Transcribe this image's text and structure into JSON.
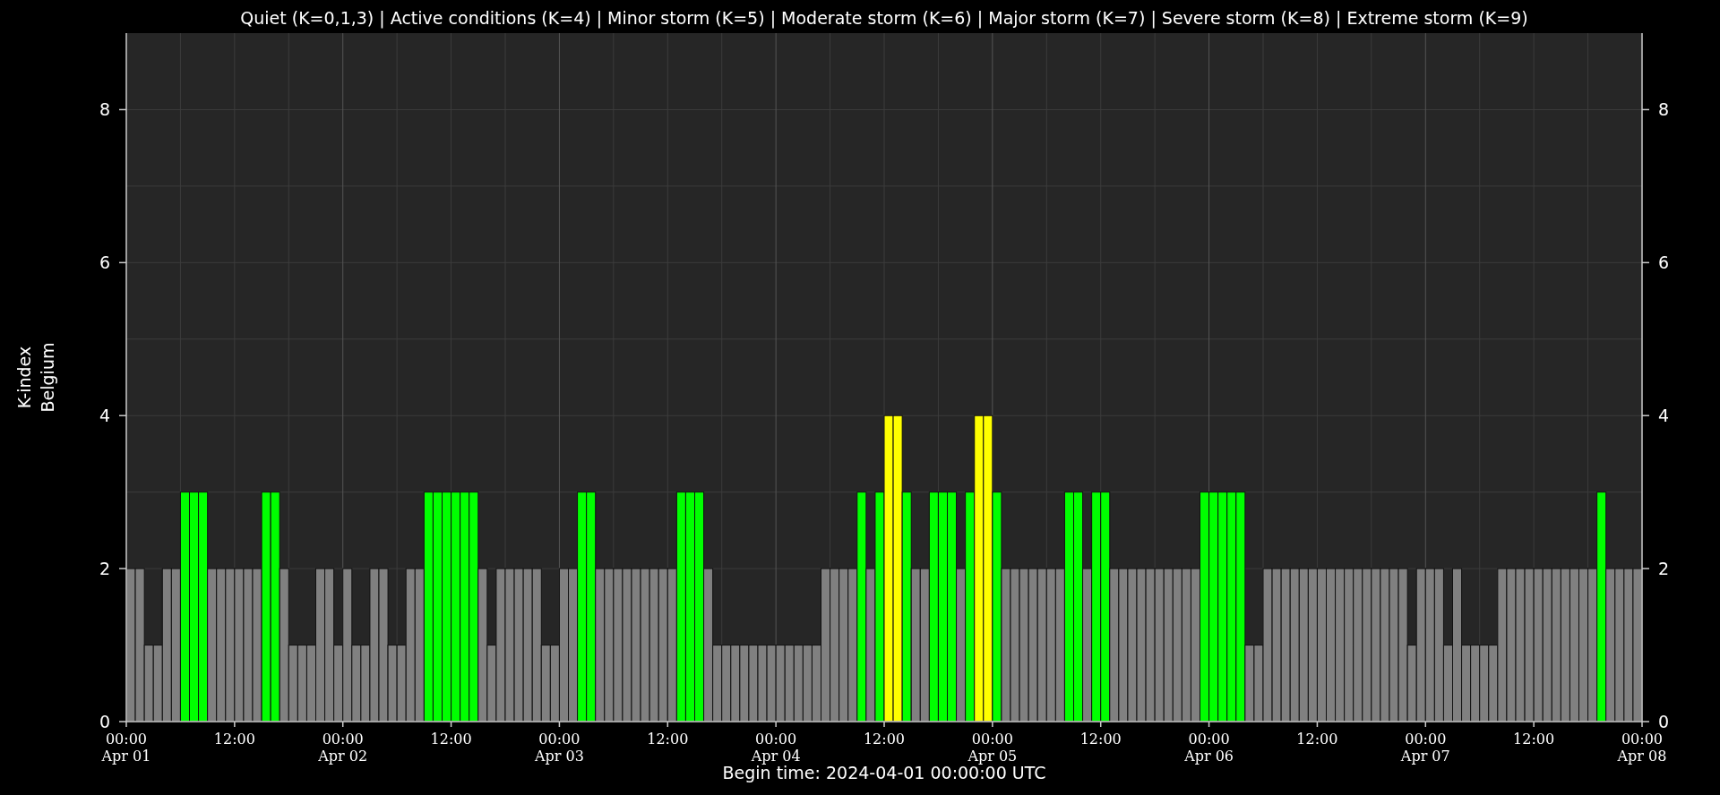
{
  "chart_data": {
    "type": "bar",
    "grid": true,
    "title": "Quiet (K=0,1,3) | Active conditions (K=4) | Minor storm (K=5) | Moderate storm (K=6) | Major storm (K=7) | Severe storm (K=8) | Extreme storm (K=9)",
    "ylabel": [
      "K-index",
      "Belgium"
    ],
    "xlabel": "Begin time: 2024-04-01 00:00:00 UTC",
    "xlim": [
      "2024-04-01T00:00",
      "2024-04-08T00:00"
    ],
    "ylim": [
      0,
      9
    ],
    "yticks": [
      0,
      2,
      4,
      6,
      8
    ],
    "y2lim": [
      0,
      9
    ],
    "y2ticks": [
      0,
      2,
      4,
      6,
      8
    ],
    "xticks": [
      {
        "value": "2024-04-01T00:00",
        "label": "00:00\nApr 01"
      },
      {
        "value": "2024-04-01T12:00",
        "label": "12:00"
      },
      {
        "value": "2024-04-02T00:00",
        "label": "00:00\nApr 02"
      },
      {
        "value": "2024-04-02T12:00",
        "label": "12:00"
      },
      {
        "value": "2024-04-03T00:00",
        "label": "00:00\nApr 03"
      },
      {
        "value": "2024-04-03T12:00",
        "label": "12:00"
      },
      {
        "value": "2024-04-04T00:00",
        "label": "00:00\nApr 04"
      },
      {
        "value": "2024-04-04T12:00",
        "label": "12:00"
      },
      {
        "value": "2024-04-05T00:00",
        "label": "00:00\nApr 05"
      },
      {
        "value": "2024-04-05T12:00",
        "label": "12:00"
      },
      {
        "value": "2024-04-06T00:00",
        "label": "00:00\nApr 06"
      },
      {
        "value": "2024-04-06T12:00",
        "label": "12:00"
      },
      {
        "value": "2024-04-07T00:00",
        "label": "00:00\nApr 07"
      },
      {
        "value": "2024-04-07T12:00",
        "label": "12:00"
      },
      {
        "value": "2024-04-08T00:00",
        "label": "00:00\nApr 08"
      }
    ],
    "x": [
      "2024-04-01T00:00",
      "2024-04-01T01:00",
      "2024-04-01T02:00",
      "2024-04-01T03:00",
      "2024-04-01T04:00",
      "2024-04-01T05:00",
      "2024-04-01T06:00",
      "2024-04-01T07:00",
      "2024-04-01T08:00",
      "2024-04-01T09:00",
      "2024-04-01T10:00",
      "2024-04-01T11:00",
      "2024-04-01T12:00",
      "2024-04-01T13:00",
      "2024-04-01T14:00",
      "2024-04-01T15:00",
      "2024-04-01T16:00",
      "2024-04-01T17:00",
      "2024-04-01T18:00",
      "2024-04-01T19:00",
      "2024-04-01T20:00",
      "2024-04-01T21:00",
      "2024-04-01T22:00",
      "2024-04-01T23:00",
      "2024-04-02T00:00",
      "2024-04-02T01:00",
      "2024-04-02T02:00",
      "2024-04-02T03:00",
      "2024-04-02T04:00",
      "2024-04-02T05:00",
      "2024-04-02T06:00",
      "2024-04-02T07:00",
      "2024-04-02T08:00",
      "2024-04-02T09:00",
      "2024-04-02T10:00",
      "2024-04-02T11:00",
      "2024-04-02T12:00",
      "2024-04-02T13:00",
      "2024-04-02T14:00",
      "2024-04-02T15:00",
      "2024-04-02T16:00",
      "2024-04-02T17:00",
      "2024-04-02T18:00",
      "2024-04-02T19:00",
      "2024-04-02T20:00",
      "2024-04-02T21:00",
      "2024-04-02T22:00",
      "2024-04-02T23:00",
      "2024-04-03T00:00",
      "2024-04-03T01:00",
      "2024-04-03T02:00",
      "2024-04-03T03:00",
      "2024-04-03T04:00",
      "2024-04-03T05:00",
      "2024-04-03T06:00",
      "2024-04-03T07:00",
      "2024-04-03T08:00",
      "2024-04-03T09:00",
      "2024-04-03T10:00",
      "2024-04-03T11:00",
      "2024-04-03T12:00",
      "2024-04-03T13:00",
      "2024-04-03T14:00",
      "2024-04-03T15:00",
      "2024-04-03T16:00",
      "2024-04-03T17:00",
      "2024-04-03T18:00",
      "2024-04-03T19:00",
      "2024-04-03T20:00",
      "2024-04-03T21:00",
      "2024-04-03T22:00",
      "2024-04-03T23:00",
      "2024-04-04T00:00",
      "2024-04-04T01:00",
      "2024-04-04T02:00",
      "2024-04-04T03:00",
      "2024-04-04T04:00",
      "2024-04-04T05:00",
      "2024-04-04T06:00",
      "2024-04-04T07:00",
      "2024-04-04T08:00",
      "2024-04-04T09:00",
      "2024-04-04T10:00",
      "2024-04-04T11:00",
      "2024-04-04T12:00",
      "2024-04-04T13:00",
      "2024-04-04T14:00",
      "2024-04-04T15:00",
      "2024-04-04T16:00",
      "2024-04-04T17:00",
      "2024-04-04T18:00",
      "2024-04-04T19:00",
      "2024-04-04T20:00",
      "2024-04-04T21:00",
      "2024-04-04T22:00",
      "2024-04-04T23:00",
      "2024-04-05T00:00",
      "2024-04-05T01:00",
      "2024-04-05T02:00",
      "2024-04-05T03:00",
      "2024-04-05T04:00",
      "2024-04-05T05:00",
      "2024-04-05T06:00",
      "2024-04-05T07:00",
      "2024-04-05T08:00",
      "2024-04-05T09:00",
      "2024-04-05T10:00",
      "2024-04-05T11:00",
      "2024-04-05T12:00",
      "2024-04-05T13:00",
      "2024-04-05T14:00",
      "2024-04-05T15:00",
      "2024-04-05T16:00",
      "2024-04-05T17:00",
      "2024-04-05T18:00",
      "2024-04-05T19:00",
      "2024-04-05T20:00",
      "2024-04-05T21:00",
      "2024-04-05T22:00",
      "2024-04-05T23:00",
      "2024-04-06T00:00",
      "2024-04-06T01:00",
      "2024-04-06T02:00",
      "2024-04-06T03:00",
      "2024-04-06T04:00",
      "2024-04-06T05:00",
      "2024-04-06T06:00",
      "2024-04-06T07:00",
      "2024-04-06T08:00",
      "2024-04-06T09:00",
      "2024-04-06T10:00",
      "2024-04-06T11:00",
      "2024-04-06T12:00",
      "2024-04-06T13:00",
      "2024-04-06T14:00",
      "2024-04-06T15:00",
      "2024-04-06T16:00",
      "2024-04-06T17:00",
      "2024-04-06T18:00",
      "2024-04-06T19:00",
      "2024-04-06T20:00",
      "2024-04-06T21:00",
      "2024-04-06T22:00",
      "2024-04-06T23:00",
      "2024-04-07T00:00",
      "2024-04-07T01:00",
      "2024-04-07T02:00",
      "2024-04-07T03:00",
      "2024-04-07T04:00",
      "2024-04-07T05:00",
      "2024-04-07T06:00",
      "2024-04-07T07:00",
      "2024-04-07T08:00",
      "2024-04-07T09:00",
      "2024-04-07T10:00",
      "2024-04-07T11:00",
      "2024-04-07T12:00",
      "2024-04-07T13:00",
      "2024-04-07T14:00",
      "2024-04-07T15:00",
      "2024-04-07T16:00",
      "2024-04-07T17:00",
      "2024-04-07T18:00",
      "2024-04-07T19:00",
      "2024-04-07T20:00",
      "2024-04-07T21:00",
      "2024-04-07T22:00",
      "2024-04-07T23:00"
    ],
    "series": [
      {
        "color": "#808080",
        "values": [
          2,
          2,
          1,
          1,
          2,
          2,
          null,
          null,
          null,
          2,
          2,
          2,
          2,
          2,
          2,
          null,
          null,
          2,
          1,
          1,
          1,
          2,
          2,
          1,
          2,
          1,
          1,
          2,
          2,
          1,
          1,
          2,
          2,
          null,
          null,
          null,
          null,
          null,
          null,
          2,
          1,
          2,
          2,
          2,
          2,
          2,
          1,
          1,
          2,
          2,
          null,
          null,
          2,
          2,
          2,
          2,
          2,
          2,
          2,
          2,
          2,
          null,
          null,
          null,
          2,
          1,
          1,
          1,
          1,
          1,
          1,
          1,
          1,
          1,
          1,
          1,
          1,
          2,
          2,
          2,
          2,
          null,
          2,
          null,
          null,
          null,
          null,
          2,
          2,
          null,
          null,
          null,
          2,
          null,
          null,
          null,
          null,
          2,
          2,
          2,
          2,
          2,
          2,
          2,
          null,
          null,
          2,
          null,
          null,
          2,
          2,
          2,
          2,
          2,
          2,
          2,
          2,
          2,
          2,
          null,
          null,
          null,
          null,
          null,
          1,
          1,
          2,
          2,
          2,
          2,
          2,
          2,
          2,
          2,
          2,
          2,
          2,
          2,
          2,
          2,
          2,
          2,
          1,
          2,
          2,
          2,
          1,
          2,
          1,
          1,
          1,
          1,
          2,
          2,
          2,
          2,
          2,
          2,
          2,
          2,
          2,
          2,
          2,
          null,
          2,
          2,
          2,
          2
        ]
      },
      {
        "color": "#00ff00",
        "values": [
          null,
          null,
          null,
          null,
          null,
          null,
          3,
          3,
          3,
          null,
          null,
          null,
          null,
          null,
          null,
          3,
          3,
          null,
          null,
          null,
          null,
          null,
          null,
          null,
          null,
          null,
          null,
          null,
          null,
          null,
          null,
          null,
          null,
          3,
          3,
          3,
          3,
          3,
          3,
          null,
          null,
          null,
          null,
          null,
          null,
          null,
          null,
          null,
          null,
          null,
          3,
          3,
          null,
          null,
          null,
          null,
          null,
          null,
          null,
          null,
          null,
          3,
          3,
          3,
          null,
          null,
          null,
          null,
          null,
          null,
          null,
          null,
          null,
          null,
          null,
          null,
          null,
          null,
          null,
          null,
          null,
          3,
          null,
          3,
          null,
          null,
          3,
          null,
          null,
          3,
          3,
          3,
          null,
          3,
          null,
          null,
          3,
          null,
          null,
          null,
          null,
          null,
          null,
          null,
          3,
          3,
          null,
          3,
          3,
          null,
          null,
          null,
          null,
          null,
          null,
          null,
          null,
          null,
          null,
          3,
          3,
          3,
          3,
          3,
          null,
          null,
          null,
          null,
          null,
          null,
          null,
          null,
          null,
          null,
          null,
          null,
          null,
          null,
          null,
          null,
          null,
          null,
          null,
          null,
          null,
          null,
          null,
          null,
          null,
          null,
          null,
          null,
          null,
          null,
          null,
          null,
          null,
          null,
          null,
          null,
          null,
          null,
          null,
          3,
          null,
          null,
          null,
          null
        ]
      },
      {
        "color": "#ffff00",
        "values": [
          null,
          null,
          null,
          null,
          null,
          null,
          null,
          null,
          null,
          null,
          null,
          null,
          null,
          null,
          null,
          null,
          null,
          null,
          null,
          null,
          null,
          null,
          null,
          null,
          null,
          null,
          null,
          null,
          null,
          null,
          null,
          null,
          null,
          null,
          null,
          null,
          null,
          null,
          null,
          null,
          null,
          null,
          null,
          null,
          null,
          null,
          null,
          null,
          null,
          null,
          null,
          null,
          null,
          null,
          null,
          null,
          null,
          null,
          null,
          null,
          null,
          null,
          null,
          null,
          null,
          null,
          null,
          null,
          null,
          null,
          null,
          null,
          null,
          null,
          null,
          null,
          null,
          null,
          null,
          null,
          null,
          null,
          null,
          null,
          4,
          4,
          null,
          null,
          null,
          null,
          null,
          null,
          null,
          null,
          4,
          4,
          null,
          null,
          null,
          null,
          null,
          null,
          null,
          null,
          null,
          null,
          null,
          null,
          null,
          null,
          null,
          null,
          null,
          null,
          null,
          null,
          null,
          null,
          null,
          null,
          null,
          null,
          null,
          null,
          null,
          null,
          null,
          null,
          null,
          null,
          null,
          null,
          null,
          null,
          null,
          null,
          null,
          null,
          null,
          null,
          null,
          null,
          null,
          null,
          null,
          null,
          null,
          null,
          null,
          null,
          null,
          null,
          null,
          null,
          null,
          null,
          null,
          null,
          null,
          null,
          null,
          null,
          null,
          null,
          null,
          null,
          null,
          null
        ]
      }
    ]
  }
}
